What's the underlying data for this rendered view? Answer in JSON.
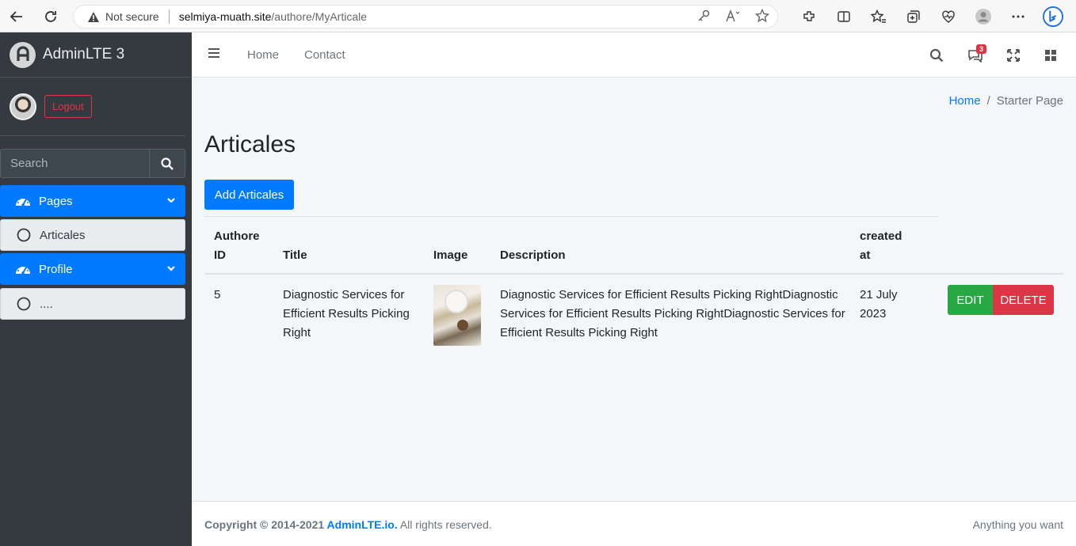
{
  "browser": {
    "security_label": "Not secure",
    "url_host": "selmiya-muath.site",
    "url_path": "/authore/MyArticale"
  },
  "sidebar": {
    "brand": "AdminLTE 3",
    "logout_label": "Logout",
    "search_placeholder": "Search",
    "items": [
      {
        "label": "Pages",
        "icon": "tachometer-icon",
        "active": true
      },
      {
        "label": "Articales",
        "icon": "circle-icon",
        "active": false
      },
      {
        "label": "Profile",
        "icon": "tachometer-icon",
        "active": true
      },
      {
        "label": "....",
        "icon": "circle-icon",
        "active": false
      }
    ]
  },
  "navbar": {
    "links": [
      "Home",
      "Contact"
    ],
    "messages_badge": "3"
  },
  "breadcrumb": {
    "home": "Home",
    "separator": "/",
    "current": "Starter Page"
  },
  "page": {
    "title": "Articales",
    "add_button": "Add Articales"
  },
  "table": {
    "headers": {
      "author_id_line1": "Authore",
      "author_id_line2": "ID",
      "title": "Title",
      "image": "Image",
      "description": "Description",
      "created_line1": "created",
      "created_line2": "at"
    },
    "rows": [
      {
        "author_id": "5",
        "title_line1": "Diagnostic Services for",
        "title_line2": "Efficient Results Picking",
        "title_line3": "Right",
        "desc_line1": "Diagnostic Services for Efficient Results Picking RightDiagnostic",
        "desc_line2": "Services for Efficient Results Picking RightDiagnostic Services for",
        "desc_line3": "Efficient Results Picking Right",
        "created_line1": "21 July",
        "created_line2": "2023",
        "edit_label": "EDIT",
        "delete_label": "DELETE"
      }
    ]
  },
  "footer": {
    "copyright_prefix": "Copyright © 2014-2021 ",
    "copyright_link": "AdminLTE.io.",
    "copyright_suffix": " All rights reserved.",
    "right_text": "Anything you want"
  },
  "colors": {
    "primary": "#007bff",
    "success": "#28a745",
    "danger": "#dc3545",
    "sidebar_bg": "#343a40"
  }
}
